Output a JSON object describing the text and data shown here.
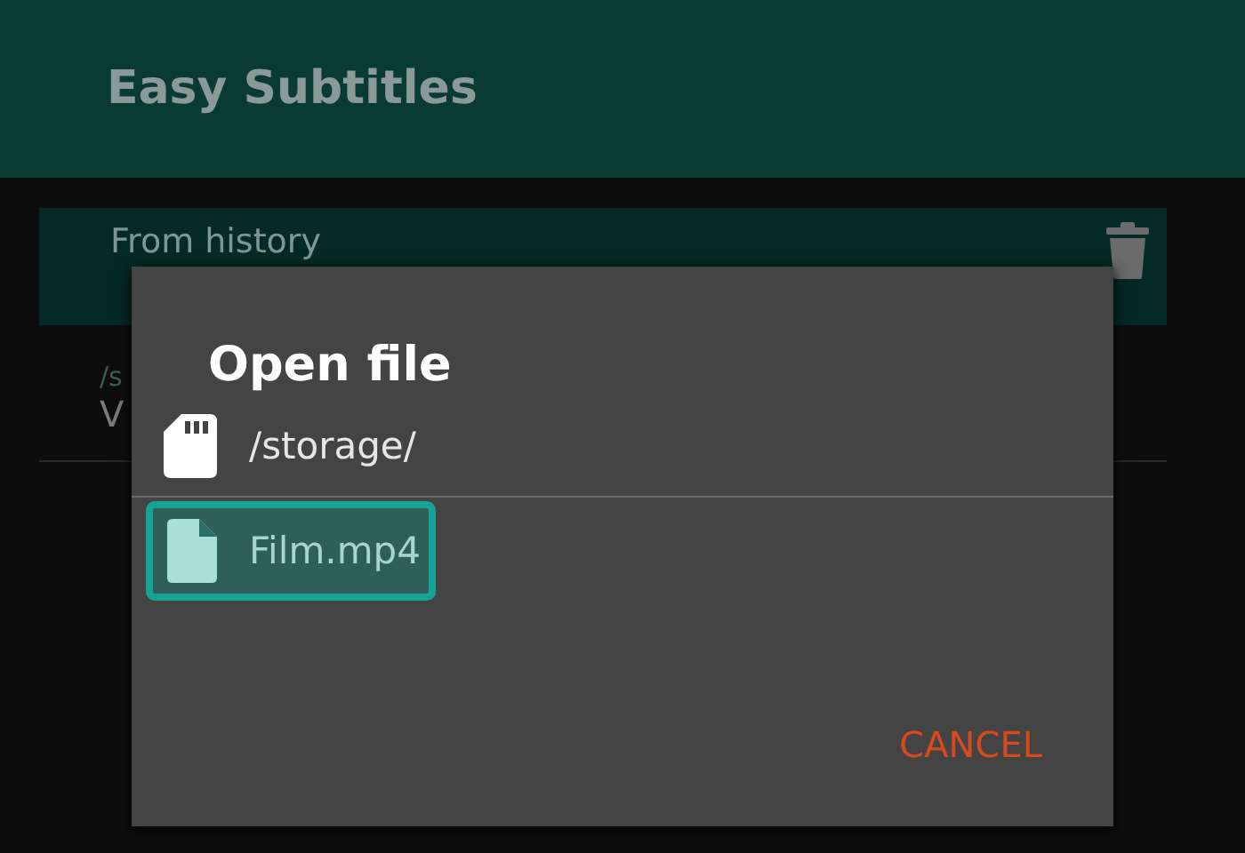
{
  "app_bar": {
    "title": "Easy Subtitles"
  },
  "history": {
    "header": "From history",
    "items": [
      {
        "path": "/s",
        "name": "V"
      }
    ]
  },
  "dialog": {
    "title": "Open file",
    "current_dir": "/storage/",
    "files": [
      {
        "name": "Film.mp4",
        "selected": true
      }
    ],
    "buttons": [
      "CANCEL"
    ]
  }
}
